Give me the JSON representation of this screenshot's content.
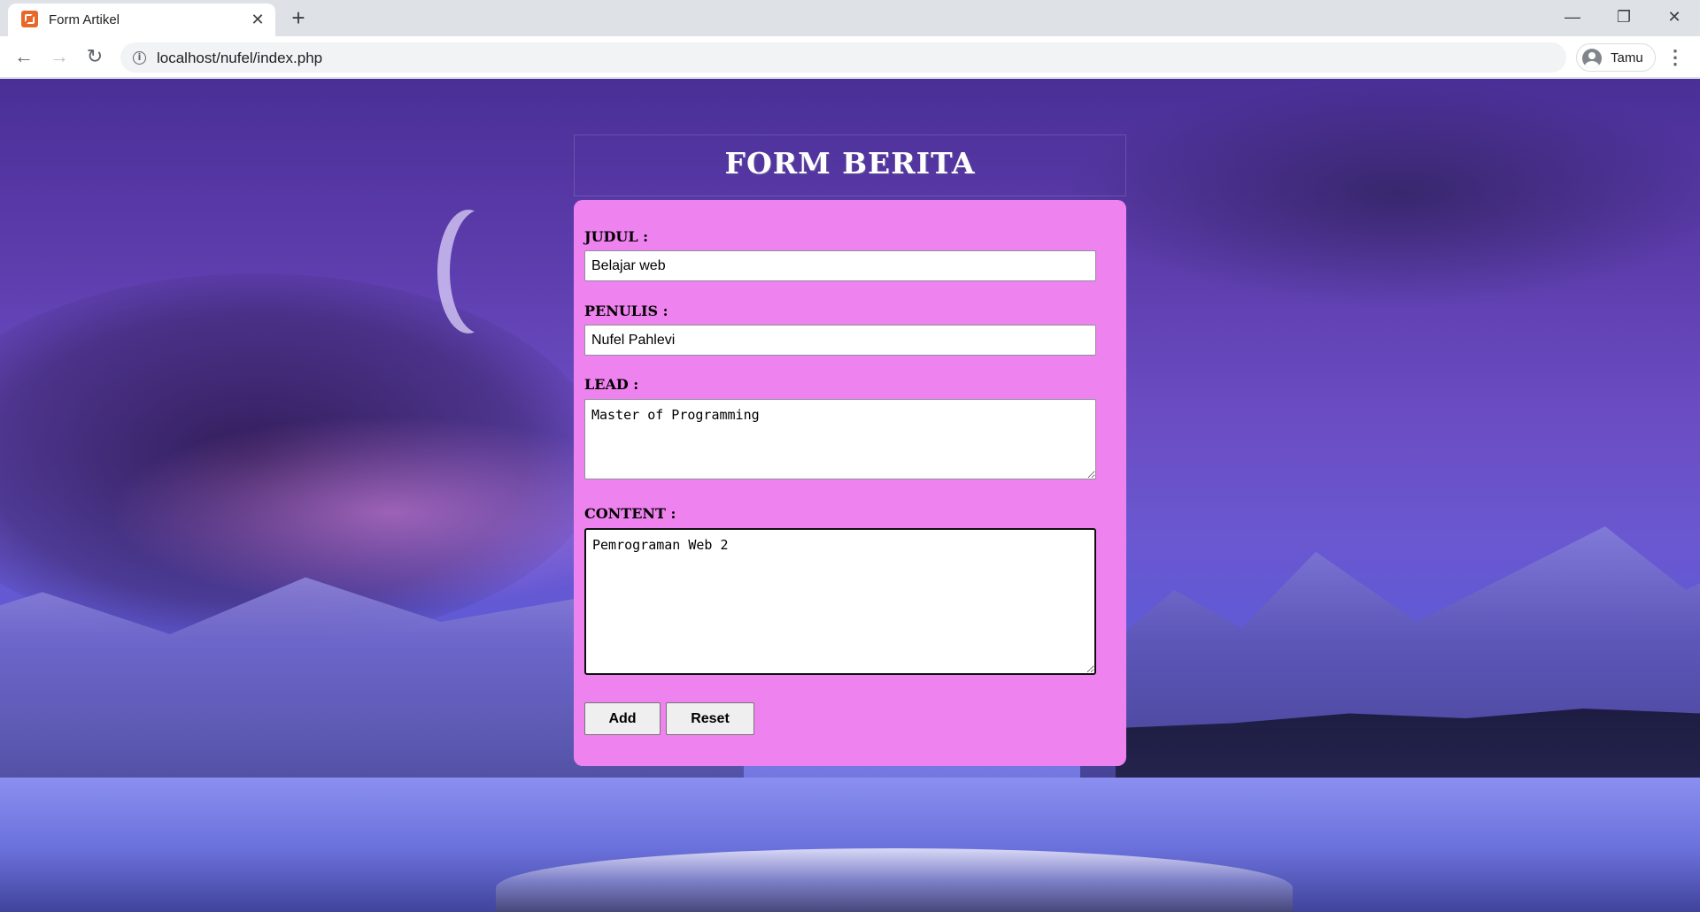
{
  "browser": {
    "tab_title": "Form Artikel",
    "tab_close": "✕",
    "new_tab": "+",
    "url": "localhost/nufel/index.php",
    "profile_name": "Tamu",
    "window_minimize": "—",
    "window_restore": "❐",
    "window_close": "✕",
    "nav_back": "←",
    "nav_forward": "→",
    "nav_reload": "↻",
    "menu": "⋮",
    "info": "i"
  },
  "form": {
    "title": "FORM BERITA",
    "judul": {
      "label": "JUDUL :",
      "value": "Belajar web"
    },
    "penulis": {
      "label": "PENULIS :",
      "value": "Nufel Pahlevi"
    },
    "lead": {
      "label": "LEAD :",
      "value": "Master of Programming"
    },
    "content": {
      "label": "CONTENT :",
      "value": "Pemrograman Web 2"
    },
    "add_label": "Add",
    "reset_label": "Reset"
  },
  "colors": {
    "form_background": "#ee82ee",
    "tab_favicon": "#e8682a"
  }
}
